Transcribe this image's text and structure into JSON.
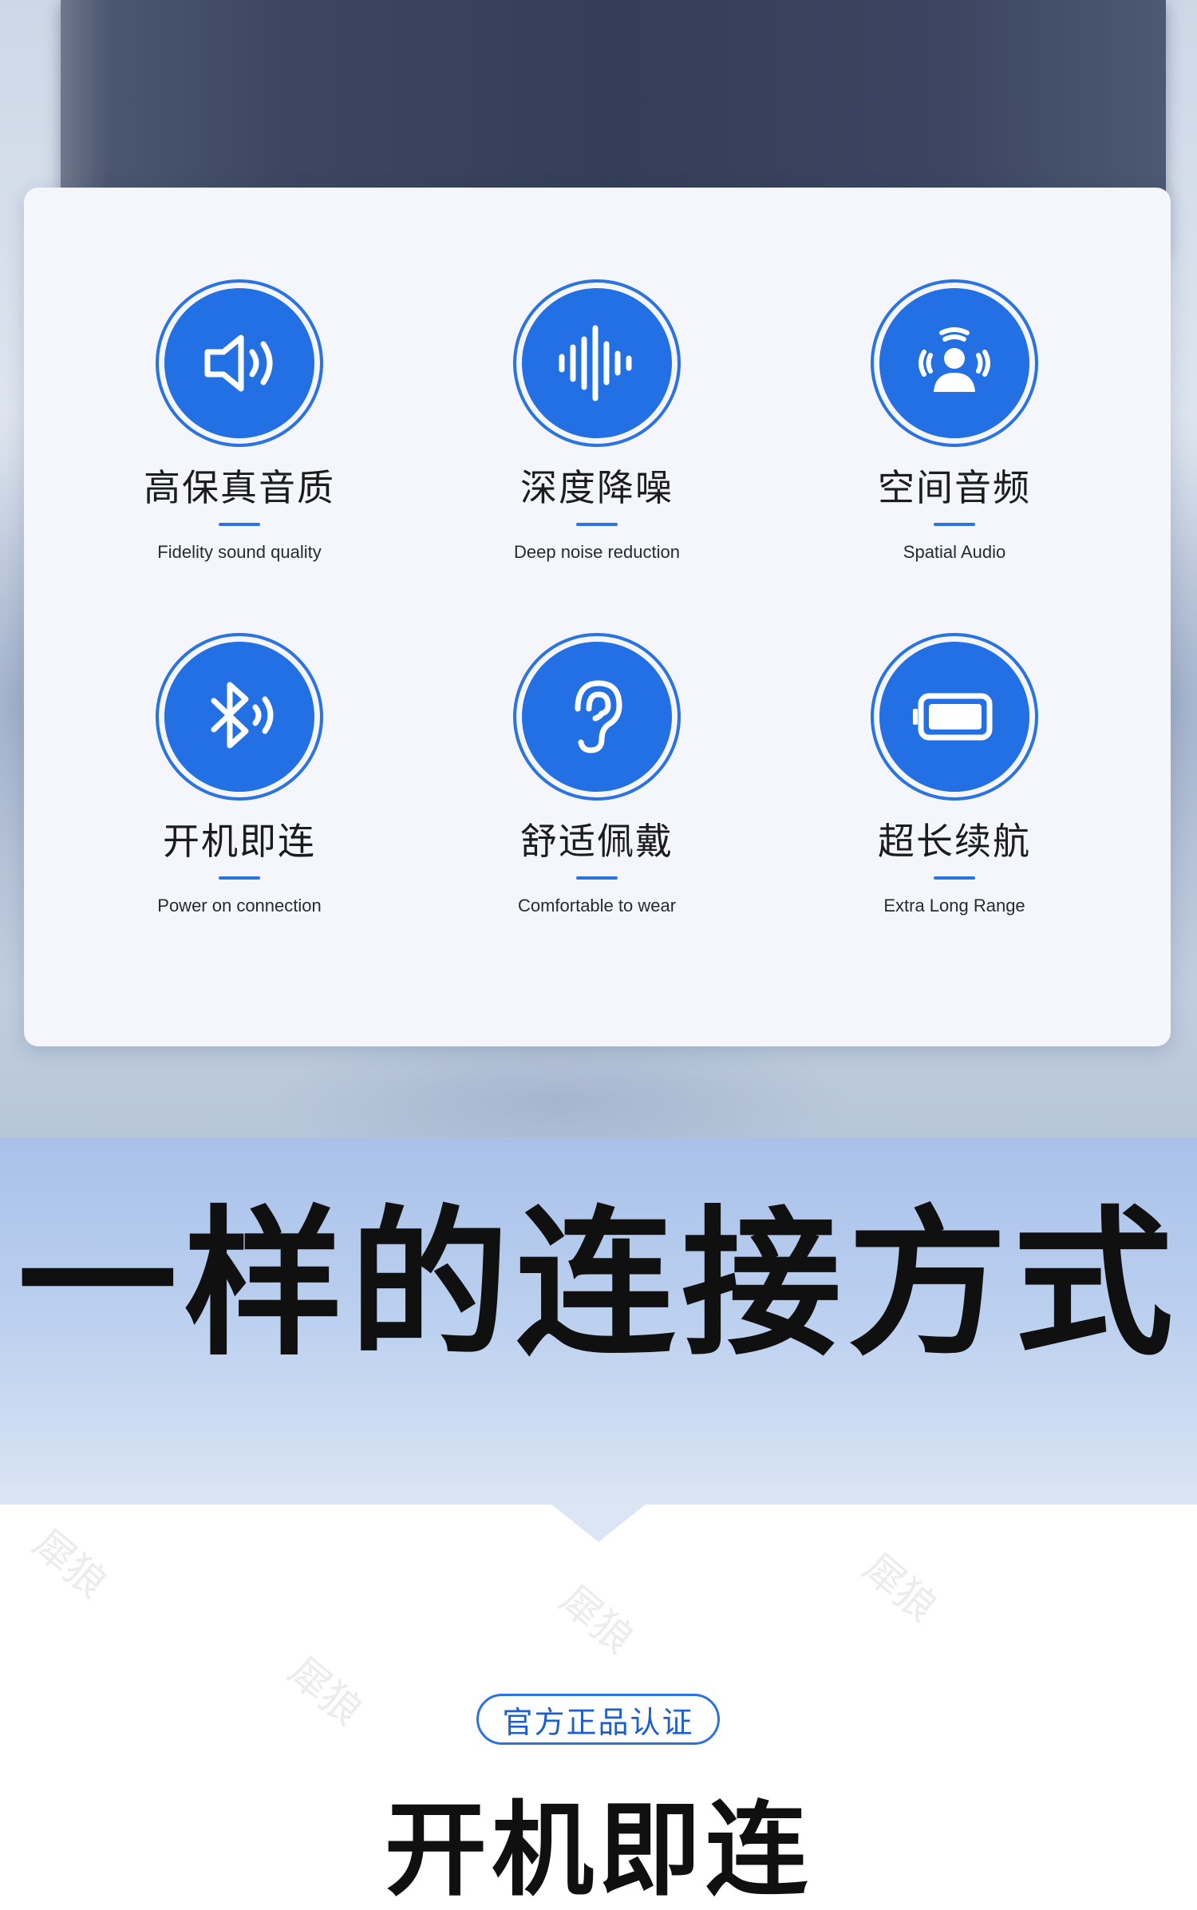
{
  "features": [
    {
      "icon": "speaker-volume-icon",
      "title": "高保真音质",
      "subtitle": "Fidelity sound quality"
    },
    {
      "icon": "sound-wave-icon",
      "title": "深度降噪",
      "subtitle": "Deep noise reduction"
    },
    {
      "icon": "spatial-audio-person-icon",
      "title": "空间音频",
      "subtitle": "Spatial Audio"
    },
    {
      "icon": "bluetooth-icon",
      "title": "开机即连",
      "subtitle": "Power on connection"
    },
    {
      "icon": "ear-icon",
      "title": "舒适佩戴",
      "subtitle": "Comfortable to wear"
    },
    {
      "icon": "battery-icon",
      "title": "超长续航",
      "subtitle": "Extra Long Range"
    }
  ],
  "headline": "一样的连接方式",
  "badge": "官方正品认证",
  "section_title": "开机即连",
  "watermark": "犀狼",
  "colors": {
    "accent": "#2370e4",
    "band": "#a9c1e9"
  }
}
